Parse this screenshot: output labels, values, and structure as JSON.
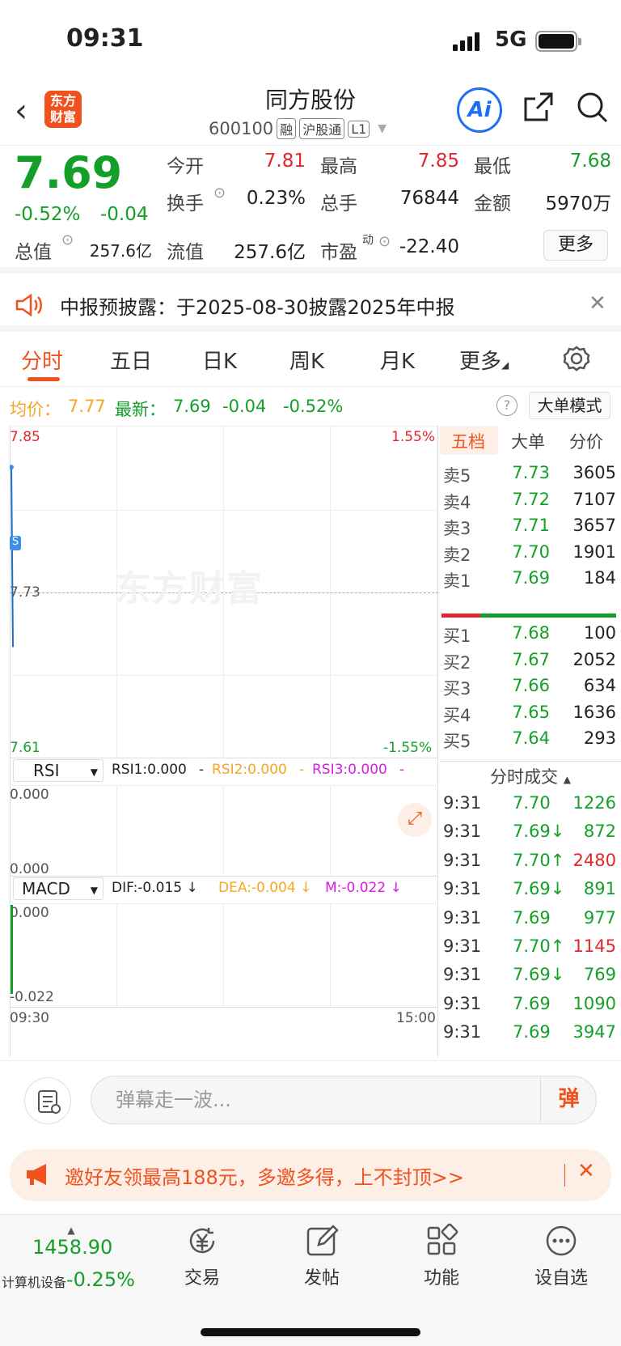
{
  "status_bar": {
    "time": "09:31",
    "network": "5G"
  },
  "header": {
    "stock_name": "同方股份",
    "stock_code": "600100",
    "tags": [
      "融",
      "沪股通",
      "L1"
    ],
    "logo_text": "东方财富",
    "ai_label": "Ai"
  },
  "quote": {
    "price": "7.69",
    "change_pct": "-0.52%",
    "change": "-0.04",
    "fields": {
      "open_label": "今开",
      "open": "7.81",
      "high_label": "最高",
      "high": "7.85",
      "low_label": "最低",
      "low": "7.68",
      "turnover_label": "换手",
      "turnover": "0.23%",
      "volume_label": "总手",
      "volume": "76844",
      "amount_label": "金额",
      "amount": "5970万",
      "mcap_label": "总值",
      "mcap": "257.6亿",
      "float_label": "流值",
      "float": "257.6亿",
      "pe_label": "市盈",
      "pe_sup": "动",
      "pe": "-22.40"
    },
    "more_label": "更多"
  },
  "notice": {
    "text": "中报预披露：于2025-08-30披露2025年中报"
  },
  "tabs": [
    "分时",
    "五日",
    "日K",
    "周K",
    "月K",
    "更多"
  ],
  "info_row": {
    "avg_label": "均价：",
    "avg": "7.77",
    "latest_label": "最新：",
    "latest": "7.69",
    "change": "-0.04",
    "change_pct": "-0.52%",
    "big_order_mode": "大单模式"
  },
  "chart": {
    "y_top": "7.85",
    "y_mid": "7.73",
    "y_bottom": "7.61",
    "pct_top": "1.55%",
    "pct_bottom": "-1.55%",
    "watermark": "东方财富",
    "rsi": {
      "name": "RSI",
      "rsi1": "RSI1:0.000",
      "rsi2": "RSI2:0.000",
      "rsi3": "RSI3:0.000",
      "sep": "-",
      "top": "0.000",
      "bottom": "0.000"
    },
    "macd": {
      "name": "MACD",
      "dif": "DIF:-0.015",
      "dea": "DEA:-0.004",
      "m": "M:-0.022",
      "arrow": "↓",
      "top": "0.000",
      "bottom": "-0.022"
    },
    "time_start": "09:30",
    "time_end": "15:00",
    "badge": "S"
  },
  "chart_data": {
    "type": "line",
    "x": [
      "09:30",
      "09:31"
    ],
    "series": [
      {
        "name": "",
        "values": [
          7.82,
          7.69
        ]
      }
    ],
    "ylim": [
      7.61,
      7.85
    ],
    "xlabel": "",
    "ylabel": ""
  },
  "order_book": {
    "tabs": [
      "五档",
      "大单",
      "分价"
    ],
    "asks": [
      {
        "label": "卖5",
        "price": "7.73",
        "vol": "3605",
        "color": "green"
      },
      {
        "label": "卖4",
        "price": "7.72",
        "vol": "7107",
        "color": "green"
      },
      {
        "label": "卖3",
        "price": "7.71",
        "vol": "3657",
        "color": "green"
      },
      {
        "label": "卖2",
        "price": "7.70",
        "vol": "1901",
        "color": "green"
      },
      {
        "label": "卖1",
        "price": "7.69",
        "vol": "184",
        "color": "green"
      }
    ],
    "bids": [
      {
        "label": "买1",
        "price": "7.68",
        "vol": "100",
        "color": "green"
      },
      {
        "label": "买2",
        "price": "7.67",
        "vol": "2052",
        "color": "green"
      },
      {
        "label": "买3",
        "price": "7.66",
        "vol": "634",
        "color": "green"
      },
      {
        "label": "买4",
        "price": "7.65",
        "vol": "1636",
        "color": "green"
      },
      {
        "label": "买5",
        "price": "7.64",
        "vol": "293",
        "color": "green"
      }
    ],
    "trades_title": "分时成交",
    "trades": [
      {
        "time": "9:31",
        "price": "7.70",
        "arrow": "",
        "vol": "1226",
        "pcolor": "green",
        "vcolor": "green"
      },
      {
        "time": "9:31",
        "price": "7.69",
        "arrow": "↓",
        "vol": "872",
        "pcolor": "green",
        "vcolor": "green"
      },
      {
        "time": "9:31",
        "price": "7.70",
        "arrow": "↑",
        "vol": "2480",
        "pcolor": "green",
        "vcolor": "red"
      },
      {
        "time": "9:31",
        "price": "7.69",
        "arrow": "↓",
        "vol": "891",
        "pcolor": "green",
        "vcolor": "green"
      },
      {
        "time": "9:31",
        "price": "7.69",
        "arrow": "",
        "vol": "977",
        "pcolor": "green",
        "vcolor": "green"
      },
      {
        "time": "9:31",
        "price": "7.70",
        "arrow": "↑",
        "vol": "1145",
        "pcolor": "green",
        "vcolor": "red"
      },
      {
        "time": "9:31",
        "price": "7.69",
        "arrow": "↓",
        "vol": "769",
        "pcolor": "green",
        "vcolor": "green"
      },
      {
        "time": "9:31",
        "price": "7.69",
        "arrow": "",
        "vol": "1090",
        "pcolor": "green",
        "vcolor": "green"
      },
      {
        "time": "9:31",
        "price": "7.69",
        "arrow": "",
        "vol": "3947",
        "pcolor": "green",
        "vcolor": "green"
      }
    ]
  },
  "comment": {
    "placeholder": "弹幕走一波...",
    "danmu_label": "弹"
  },
  "promo": {
    "text": "邀好友领最高188元，多邀多得，上不封顶>>"
  },
  "bottom_nav": {
    "index_value": "1458.90",
    "index_name": "计算机设备",
    "index_change": "-0.25%",
    "items": [
      "交易",
      "发帖",
      "功能",
      "设自选"
    ]
  },
  "colors": {
    "accent": "#f1521d",
    "up": "#e3262b",
    "down": "#14a028",
    "ai": "#1e6ef2"
  }
}
